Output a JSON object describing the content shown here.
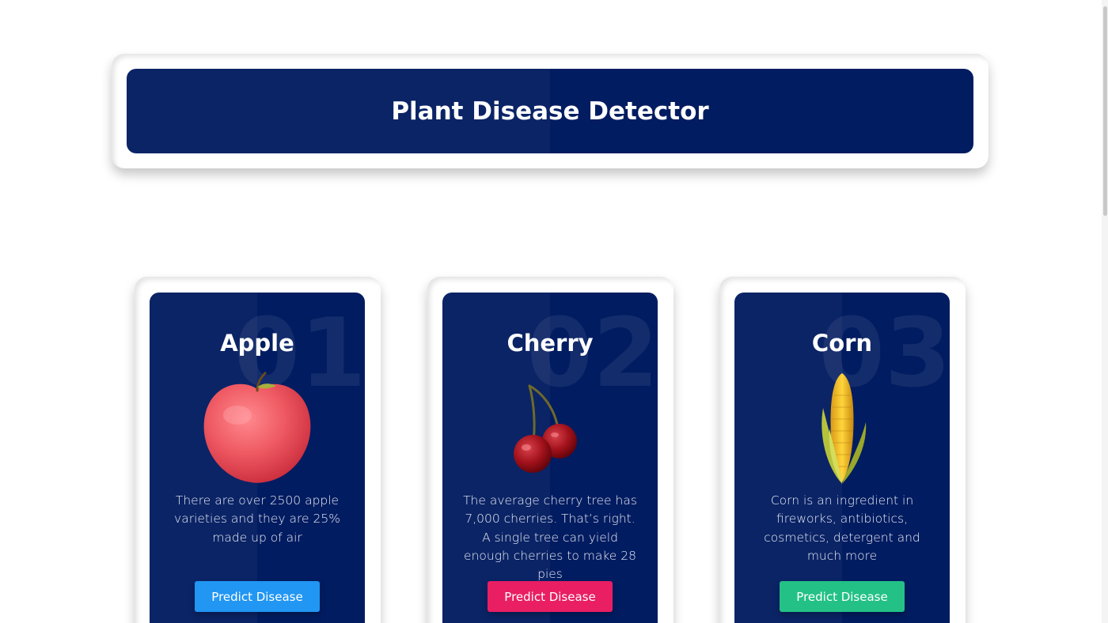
{
  "header": {
    "title": "Plant Disease Detector"
  },
  "cards": [
    {
      "number": "01",
      "title": "Apple",
      "image": "apple-image",
      "description": "There are over 2500 apple varieties and they are 25% made up of air",
      "button_label": "Predict Disease",
      "button_color": "#2196f3"
    },
    {
      "number": "02",
      "title": "Cherry",
      "image": "cherry-image",
      "description": "The average cherry tree has 7,000 cherries. That’s right. A single tree can yield enough cherries to make 28 pies",
      "button_label": "Predict Disease",
      "button_color": "#e91e63"
    },
    {
      "number": "03",
      "title": "Corn",
      "image": "corn-image",
      "description": "Corn is an ingredient in fireworks, antibiotics, cosmetics, detergent and much more",
      "button_label": "Predict Disease",
      "button_color": "#23c186"
    }
  ],
  "colors": {
    "panel_dark": "#021c61",
    "panel_light": "#0b2466",
    "text": "#ffffff"
  }
}
